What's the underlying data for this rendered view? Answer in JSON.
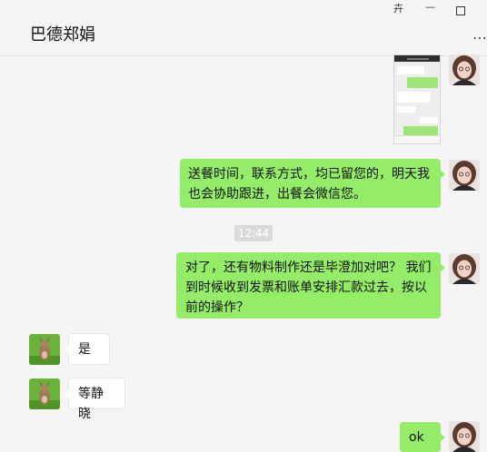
{
  "window": {
    "title": "巴德郑娟",
    "pin_icon": "pin-icon",
    "minimize_icon": "minimize-icon",
    "maximize_icon": "maximize-icon",
    "more_icon": "more-icon",
    "pin_glyph": "卉",
    "minimize_glyph": "—",
    "more_glyph": "⋯"
  },
  "messages": [
    {
      "type": "image",
      "from": "me"
    },
    {
      "type": "text",
      "from": "me",
      "text": "送餐时间，联系方式，均已留您的，明天我也会协助跟进，出餐会微信您。"
    },
    {
      "type": "time",
      "text": "12:44"
    },
    {
      "type": "text",
      "from": "me",
      "text": "对了，还有物料制作还是毕澄加对吧？ 我们到时候收到发票和账单安排汇款过去，按以前的操作？"
    },
    {
      "type": "text",
      "from": "other",
      "text": "是"
    },
    {
      "type": "text",
      "from": "other",
      "text": "等静晓"
    },
    {
      "type": "text",
      "from": "me",
      "text": "ok"
    }
  ],
  "colors": {
    "my_bubble": "#95ec69",
    "other_bubble": "#ffffff",
    "background": "#f5f5f5"
  }
}
